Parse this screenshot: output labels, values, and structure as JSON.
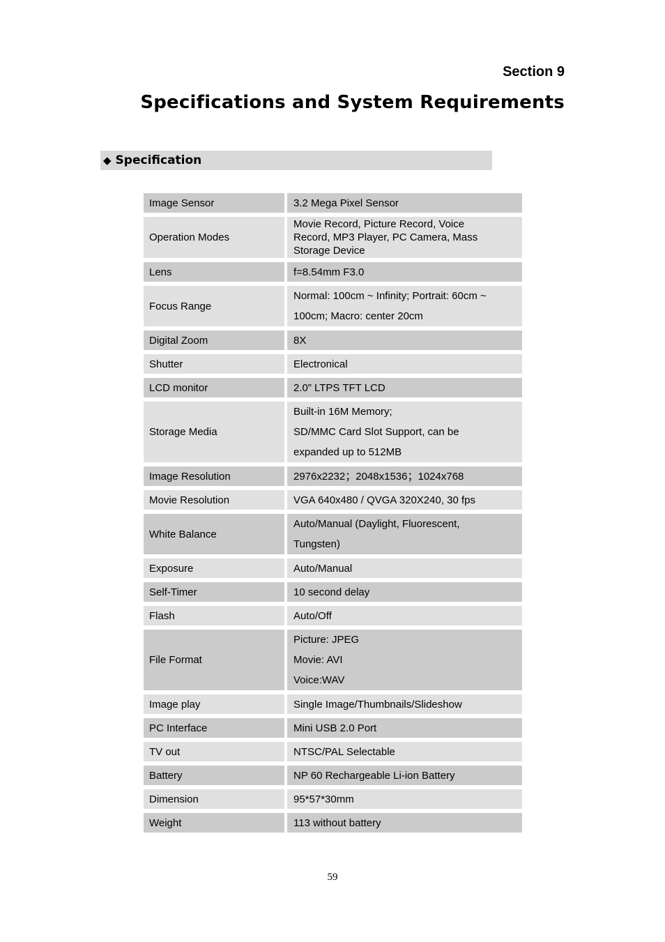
{
  "header": {
    "section": "Section 9",
    "title": "Specifications and System Requirements"
  },
  "spec_section": {
    "icon": "diamond-bullet-icon",
    "bullet": "◆",
    "label": "Specification"
  },
  "colors": {
    "row_dark": "#cbcbcb",
    "row_light": "#e0e0e0",
    "header_band": "#d9d9d9"
  },
  "specs": [
    {
      "label": "Image Sensor",
      "value": [
        "3.2 Mega Pixel Sensor"
      ],
      "shade": "dark"
    },
    {
      "label": "Operation Modes",
      "value": [
        "Movie Record, Picture Record, Voice",
        "Record, MP3 Player, PC Camera, Mass",
        "Storage Device"
      ],
      "shade": "light",
      "tight": true
    },
    {
      "label": "Lens",
      "value": [
        "f=8.54mm F3.0"
      ],
      "shade": "dark"
    },
    {
      "label": "Focus Range",
      "value": [
        "Normal: 100cm ~ Infinity; Portrait: 60cm ~",
        "100cm; Macro: center 20cm"
      ],
      "shade": "light"
    },
    {
      "label": "Digital Zoom",
      "value": [
        "8X"
      ],
      "shade": "dark"
    },
    {
      "label": "Shutter",
      "value": [
        "Electronical"
      ],
      "shade": "light"
    },
    {
      "label": "LCD monitor",
      "value": [
        "2.0” LTPS TFT LCD"
      ],
      "shade": "dark"
    },
    {
      "label": "Storage Media",
      "value": [
        "Built-in 16M Memory;",
        "SD/MMC Card Slot Support, can be",
        "expanded up to   512MB"
      ],
      "shade": "light"
    },
    {
      "label": "Image Resolution",
      "value": [
        "2976x2232；2048x1536；1024x768"
      ],
      "shade": "dark"
    },
    {
      "label": "Movie Resolution",
      "value": [
        "VGA 640x480 / QVGA 320X240, 30 fps"
      ],
      "shade": "light"
    },
    {
      "label": "White Balance",
      "value": [
        "Auto/Manual (Daylight, Fluorescent,",
        "Tungsten)"
      ],
      "shade": "dark"
    },
    {
      "label": "Exposure",
      "value": [
        "Auto/Manual"
      ],
      "shade": "light"
    },
    {
      "label": "Self-Timer",
      "value": [
        "10 second delay"
      ],
      "shade": "dark"
    },
    {
      "label": "Flash",
      "value": [
        "Auto/Off"
      ],
      "shade": "light"
    },
    {
      "label": "File Format",
      "value": [
        "Picture: JPEG",
        "Movie: AVI",
        "Voice:WAV"
      ],
      "shade": "dark"
    },
    {
      "label": "Image play",
      "value": [
        "Single Image/Thumbnails/Slideshow"
      ],
      "shade": "light"
    },
    {
      "label": "PC Interface",
      "value": [
        "Mini USB 2.0 Port"
      ],
      "shade": "dark"
    },
    {
      "label": "TV out",
      "value": [
        "NTSC/PAL Selectable"
      ],
      "shade": "light"
    },
    {
      "label": "Battery",
      "value": [
        "NP 60 Rechargeable Li-ion Battery"
      ],
      "shade": "dark"
    },
    {
      "label": "Dimension",
      "value": [
        "95*57*30mm"
      ],
      "shade": "light"
    },
    {
      "label": "Weight",
      "value": [
        "113 without battery"
      ],
      "shade": "dark"
    }
  ],
  "footer": {
    "page_number": "59"
  }
}
